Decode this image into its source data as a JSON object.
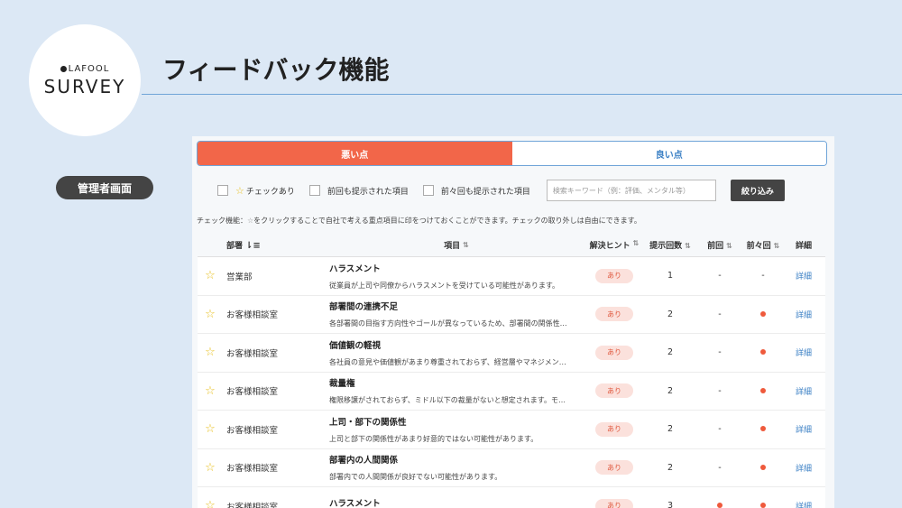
{
  "logo": {
    "brand_small": "LAFOOL",
    "brand_big": "SURVEY"
  },
  "page_title": "フィードバック機能",
  "admin_badge": "管理者画面",
  "tabs": [
    {
      "label": "悪い点",
      "active": true
    },
    {
      "label": "良い点",
      "active": false
    }
  ],
  "filters": {
    "checked_label": "チェックあり",
    "prev_label": "前回も提示された項目",
    "prev2_label": "前々回も提示された項目",
    "search_placeholder": "検索キーワード（例：評価、メンタル等）",
    "search_button": "絞り込み"
  },
  "notice": {
    "prefix": "チェック機能：",
    "suffix": "をクリックすることで自社で考える重点項目に印をつけておくことができます。チェックの取り外しは自由にできます。"
  },
  "table": {
    "headers": {
      "dept": "部署",
      "item": "項目",
      "hint": "解決ヒント",
      "count": "提示回数",
      "prev": "前回",
      "prev2": "前々回",
      "detail": "詳細"
    },
    "rows": [
      {
        "dept": "営業部",
        "title": "ハラスメント",
        "desc": "従業員が上司や同僚からハラスメントを受けている可能性があります。",
        "hint": "あり",
        "count": "1",
        "prev": "-",
        "prev2": "-",
        "detail": "詳細"
      },
      {
        "dept": "お客様相談室",
        "title": "部署間の連携不足",
        "desc": "各部署間の目指す方向性やゴールが異なっているため、部署間の関係性…",
        "hint": "あり",
        "count": "2",
        "prev": "-",
        "prev2": "dot",
        "detail": "詳細"
      },
      {
        "dept": "お客様相談室",
        "title": "価値観の軽視",
        "desc": "各社員の意見や価値観があまり尊重されておらず、経営層やマネジメン…",
        "hint": "あり",
        "count": "2",
        "prev": "-",
        "prev2": "dot",
        "detail": "詳細"
      },
      {
        "dept": "お客様相談室",
        "title": "裁量権",
        "desc": "権限移譲がされておらず、ミドル以下の裁量がないと想定されます。モ…",
        "hint": "あり",
        "count": "2",
        "prev": "-",
        "prev2": "dot",
        "detail": "詳細"
      },
      {
        "dept": "お客様相談室",
        "title": "上司・部下の関係性",
        "desc": "上司と部下の関係性があまり好意的ではない可能性があります。",
        "hint": "あり",
        "count": "2",
        "prev": "-",
        "prev2": "dot",
        "detail": "詳細"
      },
      {
        "dept": "お客様相談室",
        "title": "部署内の人間関係",
        "desc": "部署内での人間関係が良好でない可能性があります。",
        "hint": "あり",
        "count": "2",
        "prev": "-",
        "prev2": "dot",
        "detail": "詳細"
      },
      {
        "dept": "お客様相談室",
        "title": "ハラスメント",
        "desc": "",
        "hint": "あり",
        "count": "3",
        "prev": "dot",
        "prev2": "dot",
        "detail": "詳細"
      }
    ]
  },
  "colors": {
    "accent": "#f26649",
    "link": "#3a7fc4",
    "star": "#e8c020",
    "background": "#dce8f5"
  }
}
